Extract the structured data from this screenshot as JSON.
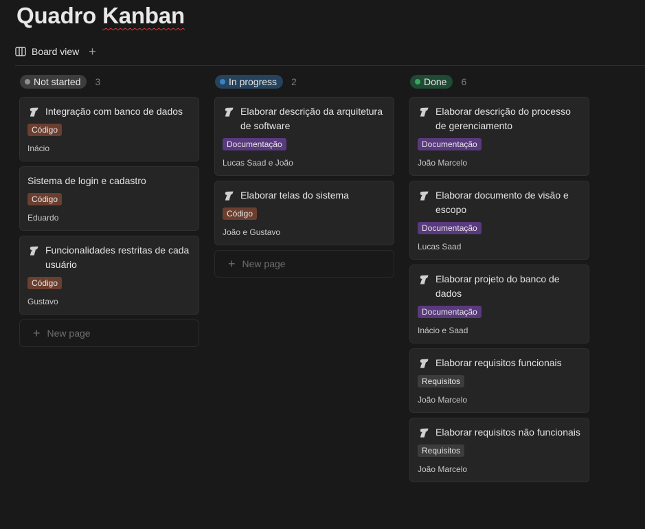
{
  "page": {
    "title_a": "Quadro ",
    "title_b": "Kanban"
  },
  "views": {
    "active_tab": "Board view",
    "add_icon": "plus-icon"
  },
  "new_page_label": "New page",
  "columns": [
    {
      "status": "Not started",
      "count": "3",
      "pill_bg": "#3d3d3d",
      "dot": "#8f8f8f",
      "cards": [
        {
          "title": "Integração com banco de dados",
          "tag": "Código",
          "tag_type": "codigo",
          "person": "Inácio",
          "icon": true
        },
        {
          "title": "Sistema de login e cadastro",
          "tag": "Código",
          "tag_type": "codigo",
          "person": "Eduardo",
          "icon": false
        },
        {
          "title": "Funcionalidades restritas de cada usuário",
          "tag": "Código",
          "tag_type": "codigo",
          "person": "Gustavo",
          "icon": true
        }
      ]
    },
    {
      "status": "In progress",
      "count": "2",
      "pill_bg": "#25435d",
      "dot": "#3b82c4",
      "cards": [
        {
          "title": "Elaborar descrição da arquitetura de software",
          "tag": "Documentação",
          "tag_type": "doc",
          "person": "Lucas Saad e João",
          "icon": true
        },
        {
          "title": "Elaborar telas do sistema",
          "tag": "Código",
          "tag_type": "codigo",
          "person": "João e Gustavo",
          "icon": true
        }
      ]
    },
    {
      "status": "Done",
      "count": "6",
      "pill_bg": "#1f4a33",
      "dot": "#3aa55d",
      "cards": [
        {
          "title": "Elaborar descrição do processo de gerenciamento",
          "tag": "Documentação",
          "tag_type": "doc",
          "person": "João Marcelo",
          "icon": true
        },
        {
          "title": "Elaborar documento de visão e escopo",
          "tag": "Documentação",
          "tag_type": "doc",
          "person": "Lucas Saad",
          "icon": true
        },
        {
          "title": "Elaborar projeto do banco de dados",
          "tag": "Documentação",
          "tag_type": "doc",
          "person": "Inácio e Saad",
          "icon": true
        },
        {
          "title": "Elaborar requisitos funcionais",
          "tag": "Requisitos",
          "tag_type": "req",
          "person": "João Marcelo",
          "icon": true
        },
        {
          "title": "Elaborar requisitos não funcionais",
          "tag": "Requisitos",
          "tag_type": "req",
          "person": "João Marcelo",
          "icon": true
        }
      ]
    }
  ]
}
